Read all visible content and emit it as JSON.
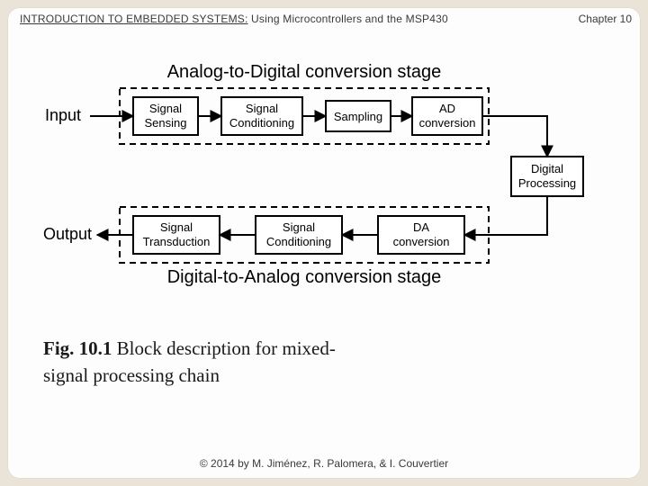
{
  "header": {
    "title_prefix": "INTRODUCTION TO EMBEDDED SYSTEMS:",
    "title_suffix": " Using Microcontrollers and the MSP430",
    "chapter": "Chapter 10"
  },
  "footer": {
    "copyright": "© 2014 by M. Jiménez, R. Palomera, & I. Couvertier"
  },
  "caption": {
    "fig_label": "Fig. 10.1",
    "text": "  Block description for mixed-signal processing chain"
  },
  "diagram": {
    "io_labels": {
      "input": "Input",
      "output": "Output"
    },
    "stage_titles": {
      "top": "Analog-to-Digital  conversion stage",
      "bottom": "Digital-to-Analog  conversion stage"
    },
    "top_blocks": {
      "b1a": "Signal",
      "b1b": "Sensing",
      "b2a": "Signal",
      "b2b": "Conditioning",
      "b3": "Sampling",
      "b4a": "AD",
      "b4b": "conversion"
    },
    "side_block": {
      "a": "Digital",
      "b": "Processing"
    },
    "bottom_blocks": {
      "b1a": "Signal",
      "b1b": "Transduction",
      "b2a": "Signal",
      "b2b": "Conditioning",
      "b3a": "DA",
      "b3b": "conversion"
    }
  }
}
